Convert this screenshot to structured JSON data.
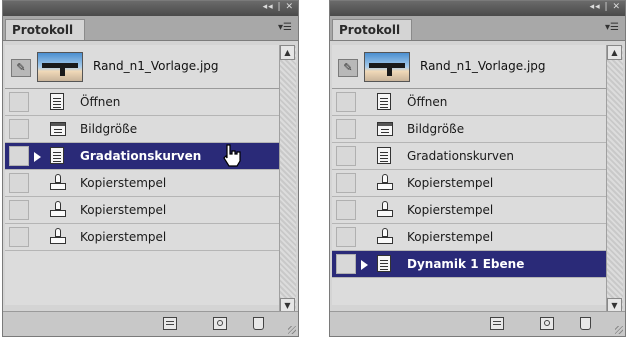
{
  "colors": {
    "selection": "#2a2a78",
    "panel_bg": "#d4d4d4"
  },
  "left_panel": {
    "tab_label": "Protokoll",
    "titlebar_icons": "◂◂ | ✕",
    "menu_icon": "▾☰",
    "snapshot_label": "Rand_n1_Vorlage.jpg",
    "steps": [
      {
        "label": "Öffnen",
        "icon": "document-icon",
        "selected": false
      },
      {
        "label": "Bildgröße",
        "icon": "window-icon",
        "selected": false
      },
      {
        "label": "Gradationskurven",
        "icon": "document-icon",
        "selected": true
      },
      {
        "label": "Kopierstempel",
        "icon": "stamp-icon",
        "selected": false
      },
      {
        "label": "Kopierstempel",
        "icon": "stamp-icon",
        "selected": false
      },
      {
        "label": "Kopierstempel",
        "icon": "stamp-icon",
        "selected": false
      }
    ]
  },
  "right_panel": {
    "tab_label": "Protokoll",
    "titlebar_icons": "◂◂ | ✕",
    "menu_icon": "▾☰",
    "snapshot_label": "Rand_n1_Vorlage.jpg",
    "steps": [
      {
        "label": "Öffnen",
        "icon": "document-icon",
        "selected": false
      },
      {
        "label": "Bildgröße",
        "icon": "window-icon",
        "selected": false
      },
      {
        "label": "Gradationskurven",
        "icon": "document-icon",
        "selected": false
      },
      {
        "label": "Kopierstempel",
        "icon": "stamp-icon",
        "selected": false
      },
      {
        "label": "Kopierstempel",
        "icon": "stamp-icon",
        "selected": false
      },
      {
        "label": "Kopierstempel",
        "icon": "stamp-icon",
        "selected": false
      },
      {
        "label": "Dynamik 1 Ebene",
        "icon": "document-icon",
        "selected": true
      }
    ]
  }
}
